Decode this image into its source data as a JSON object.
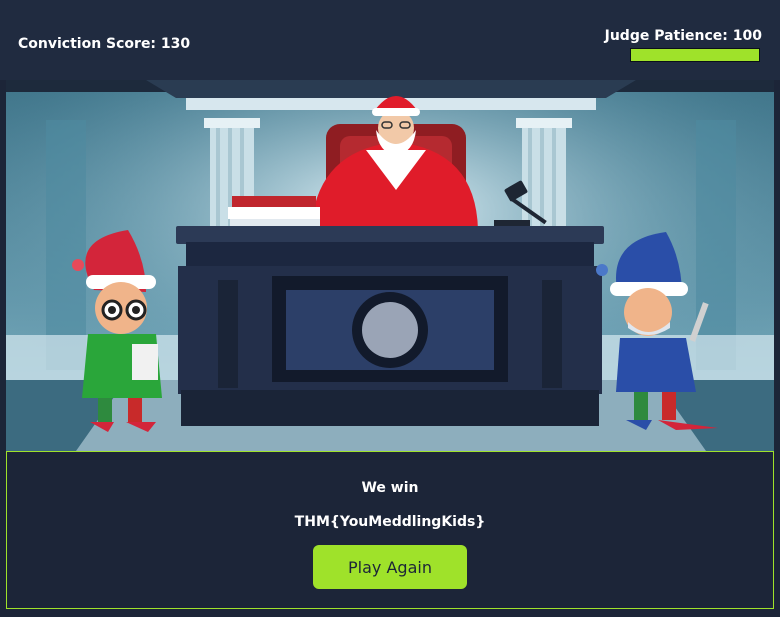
{
  "hud": {
    "score_label": "Conviction Score: 130",
    "patience_label": "Judge Patience: 100",
    "patience_value": 100,
    "patience_color": "#9fe22a"
  },
  "scene": {
    "characters": [
      "santa-judge",
      "red-hat-elf",
      "blue-hat-elf"
    ],
    "props": [
      "judge-bench",
      "gavel",
      "books",
      "courtroom-columns"
    ]
  },
  "result": {
    "title": "We win",
    "flag": "THM{YouMeddlingKids}",
    "play_again_label": "Play Again"
  },
  "colors": {
    "background": "#1c2538",
    "accent": "#9fe22a",
    "panel_border": "#9fe22a"
  }
}
